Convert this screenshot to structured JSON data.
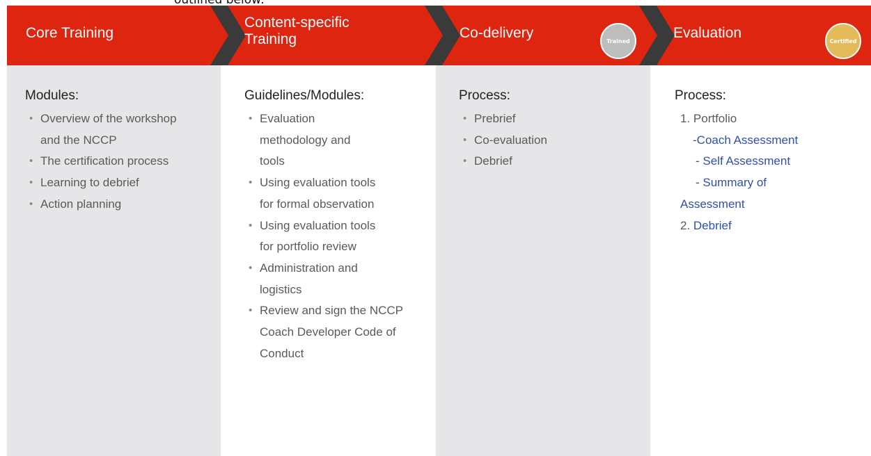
{
  "caption": "outlined below:",
  "colors": {
    "banner_red": "#dd2510",
    "chevron_dark": "#3a3a3a",
    "panel_grey": "#e6e6e9",
    "link_blue": "#2f50a6",
    "trained_badge": "#bdbdbd",
    "certified_badge": "#e3bb58"
  },
  "steps": [
    {
      "title": "Core Training",
      "heading": "Modules:",
      "items": [
        "Overview of the workshop and the NCCP",
        "The certification process",
        "Learning to debrief",
        "Action planning"
      ]
    },
    {
      "title_line1": "Content-specific",
      "title_line2": "Training",
      "heading": "Guidelines/Modules:",
      "items": [
        "Evaluation methodology and tools",
        "Using evaluation tools for formal observation",
        "Using evaluation tools for portfolio review",
        "Administration and logistics",
        "Review and sign the NCCP Coach Developer Code of Conduct"
      ]
    },
    {
      "title": "Co-delivery",
      "badge": "Trained",
      "heading": "Process:",
      "items": [
        "Prebrief",
        "Co-evaluation",
        "Debrief"
      ]
    },
    {
      "title": "Evaluation",
      "badge": "Certified",
      "heading": "Process:",
      "item1": "1. Portfolio",
      "sub1": "-Coach Assessment",
      "sub2": "- Self Assessment",
      "sub3a": "- Summary of",
      "sub3b": "Assessment",
      "item2_num": "2. ",
      "item2_link": "Debrief"
    }
  ]
}
